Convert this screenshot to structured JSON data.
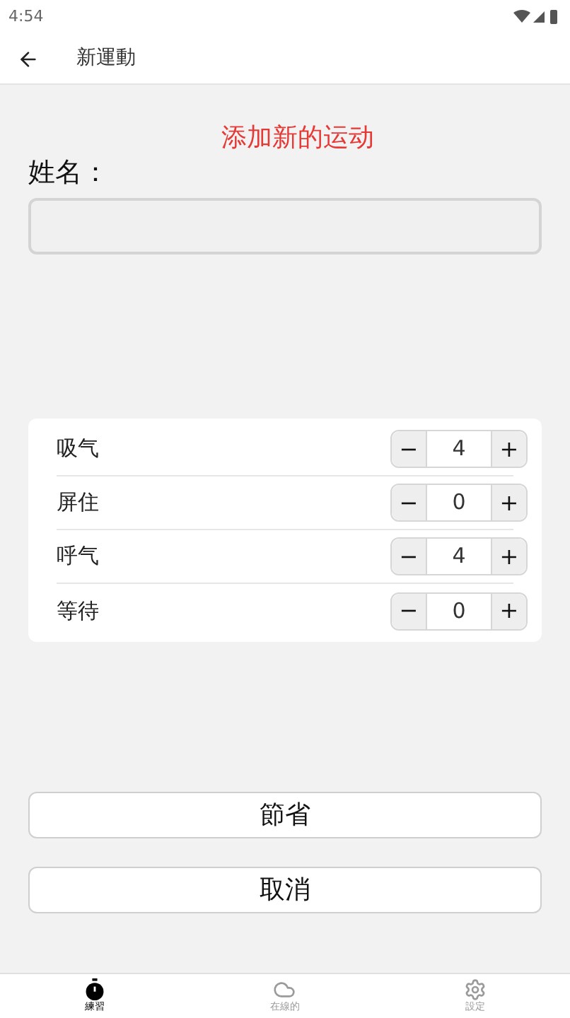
{
  "status_bar": {
    "time": "4:54"
  },
  "app_bar": {
    "title": "新運動"
  },
  "form": {
    "heading": "添加新的运动",
    "name_label": "姓名："
  },
  "phases": [
    {
      "label": "吸气",
      "value": "4",
      "minus": "−",
      "plus": "+"
    },
    {
      "label": "屏住",
      "value": "0",
      "minus": "−",
      "plus": "+"
    },
    {
      "label": "呼气",
      "value": "4",
      "minus": "−",
      "plus": "+"
    },
    {
      "label": "等待",
      "value": "0",
      "minus": "−",
      "plus": "+"
    }
  ],
  "buttons": [
    "節省",
    "取消"
  ],
  "nav": [
    {
      "label": "練習",
      "kind": "timer",
      "selected": true
    },
    {
      "label": "在線的",
      "kind": "cloud",
      "selected": false
    },
    {
      "label": "設定",
      "kind": "gear",
      "selected": false
    }
  ]
}
